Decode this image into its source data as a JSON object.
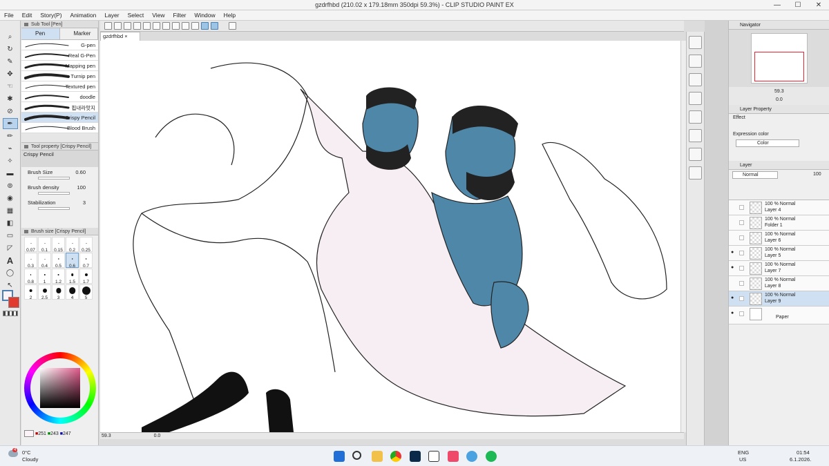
{
  "window": {
    "title": "gzdrfhbd (210.02 x 179.18mm 350dpi 59.3%) - CLIP STUDIO PAINT EX"
  },
  "menu": [
    "File",
    "Edit",
    "Story(P)",
    "Animation",
    "Layer",
    "Select",
    "View",
    "Filter",
    "Window",
    "Help"
  ],
  "document_tab": "gzdrfhbd",
  "subtool": {
    "header": "Sub Tool [Pen]",
    "tabs": [
      "Pen",
      "Marker"
    ],
    "brushes": [
      "G-pen",
      "Real G-Pen",
      "Mapping pen",
      "Turnip pen",
      "Textured pen",
      "doodle",
      "핍내라맛지",
      "Crispy Pencil",
      "Blood Brush"
    ],
    "selected_index": 7
  },
  "toolprop": {
    "header": "Tool property [Crispy Pencil]",
    "name": "Crispy Pencil",
    "brush_size_label": "Brush Size",
    "brush_size_value": "0.60",
    "density_label": "Brush density",
    "density_value": "100",
    "stabilization_label": "Stabilization",
    "stabilization_value": "3"
  },
  "brushsize": {
    "header": "Brush size [Crispy Pencil]",
    "sizes": [
      "0.07",
      "0.1",
      "0.15",
      "0.2",
      "0.25",
      "0.3",
      "0.4",
      "0.5",
      "0.6",
      "0.7",
      "0.8",
      "1",
      "1.2",
      "1.5",
      "1.7",
      "2",
      "2.5",
      "3",
      "4",
      "5"
    ],
    "selected_index": 8
  },
  "color": {
    "r": "251",
    "g": "243",
    "b": "247"
  },
  "canvas": {
    "zoom": "59.3",
    "angle": "0.0"
  },
  "navigator": {
    "tab": "Navigator",
    "zoom": "59.3",
    "angle": "0.0"
  },
  "layer_property": {
    "tab": "Layer Property",
    "effect_label": "Effect",
    "expression_label": "Expression color",
    "expression_value": "Color"
  },
  "layers": {
    "tab": "Layer",
    "blend": "Normal",
    "opacity": "100",
    "items": [
      {
        "op": "100 % Normal",
        "name": "Layer 4",
        "visible": false
      },
      {
        "op": "100 % Normal",
        "name": "Folder 1",
        "visible": false
      },
      {
        "op": "100 % Normal",
        "name": "Layer 6",
        "visible": false
      },
      {
        "op": "100 % Normal",
        "name": "Layer 5",
        "visible": true
      },
      {
        "op": "100 % Normal",
        "name": "Layer 7",
        "visible": true
      },
      {
        "op": "100 % Normal",
        "name": "Layer 8",
        "visible": false
      },
      {
        "op": "100 % Normal",
        "name": "Layer 9",
        "visible": true
      }
    ],
    "paper": "Paper"
  },
  "taskbar": {
    "weather_temp": "0°C",
    "weather_text": "Cloudy",
    "badge": "4",
    "lang1": "ENG",
    "lang2": "US",
    "time": "01:54",
    "date": "6.1.2026."
  },
  "colors": {
    "accent": "#b9d3ec",
    "skin_blue": "#4f87a8",
    "pale_pink": "#f7eef3"
  }
}
